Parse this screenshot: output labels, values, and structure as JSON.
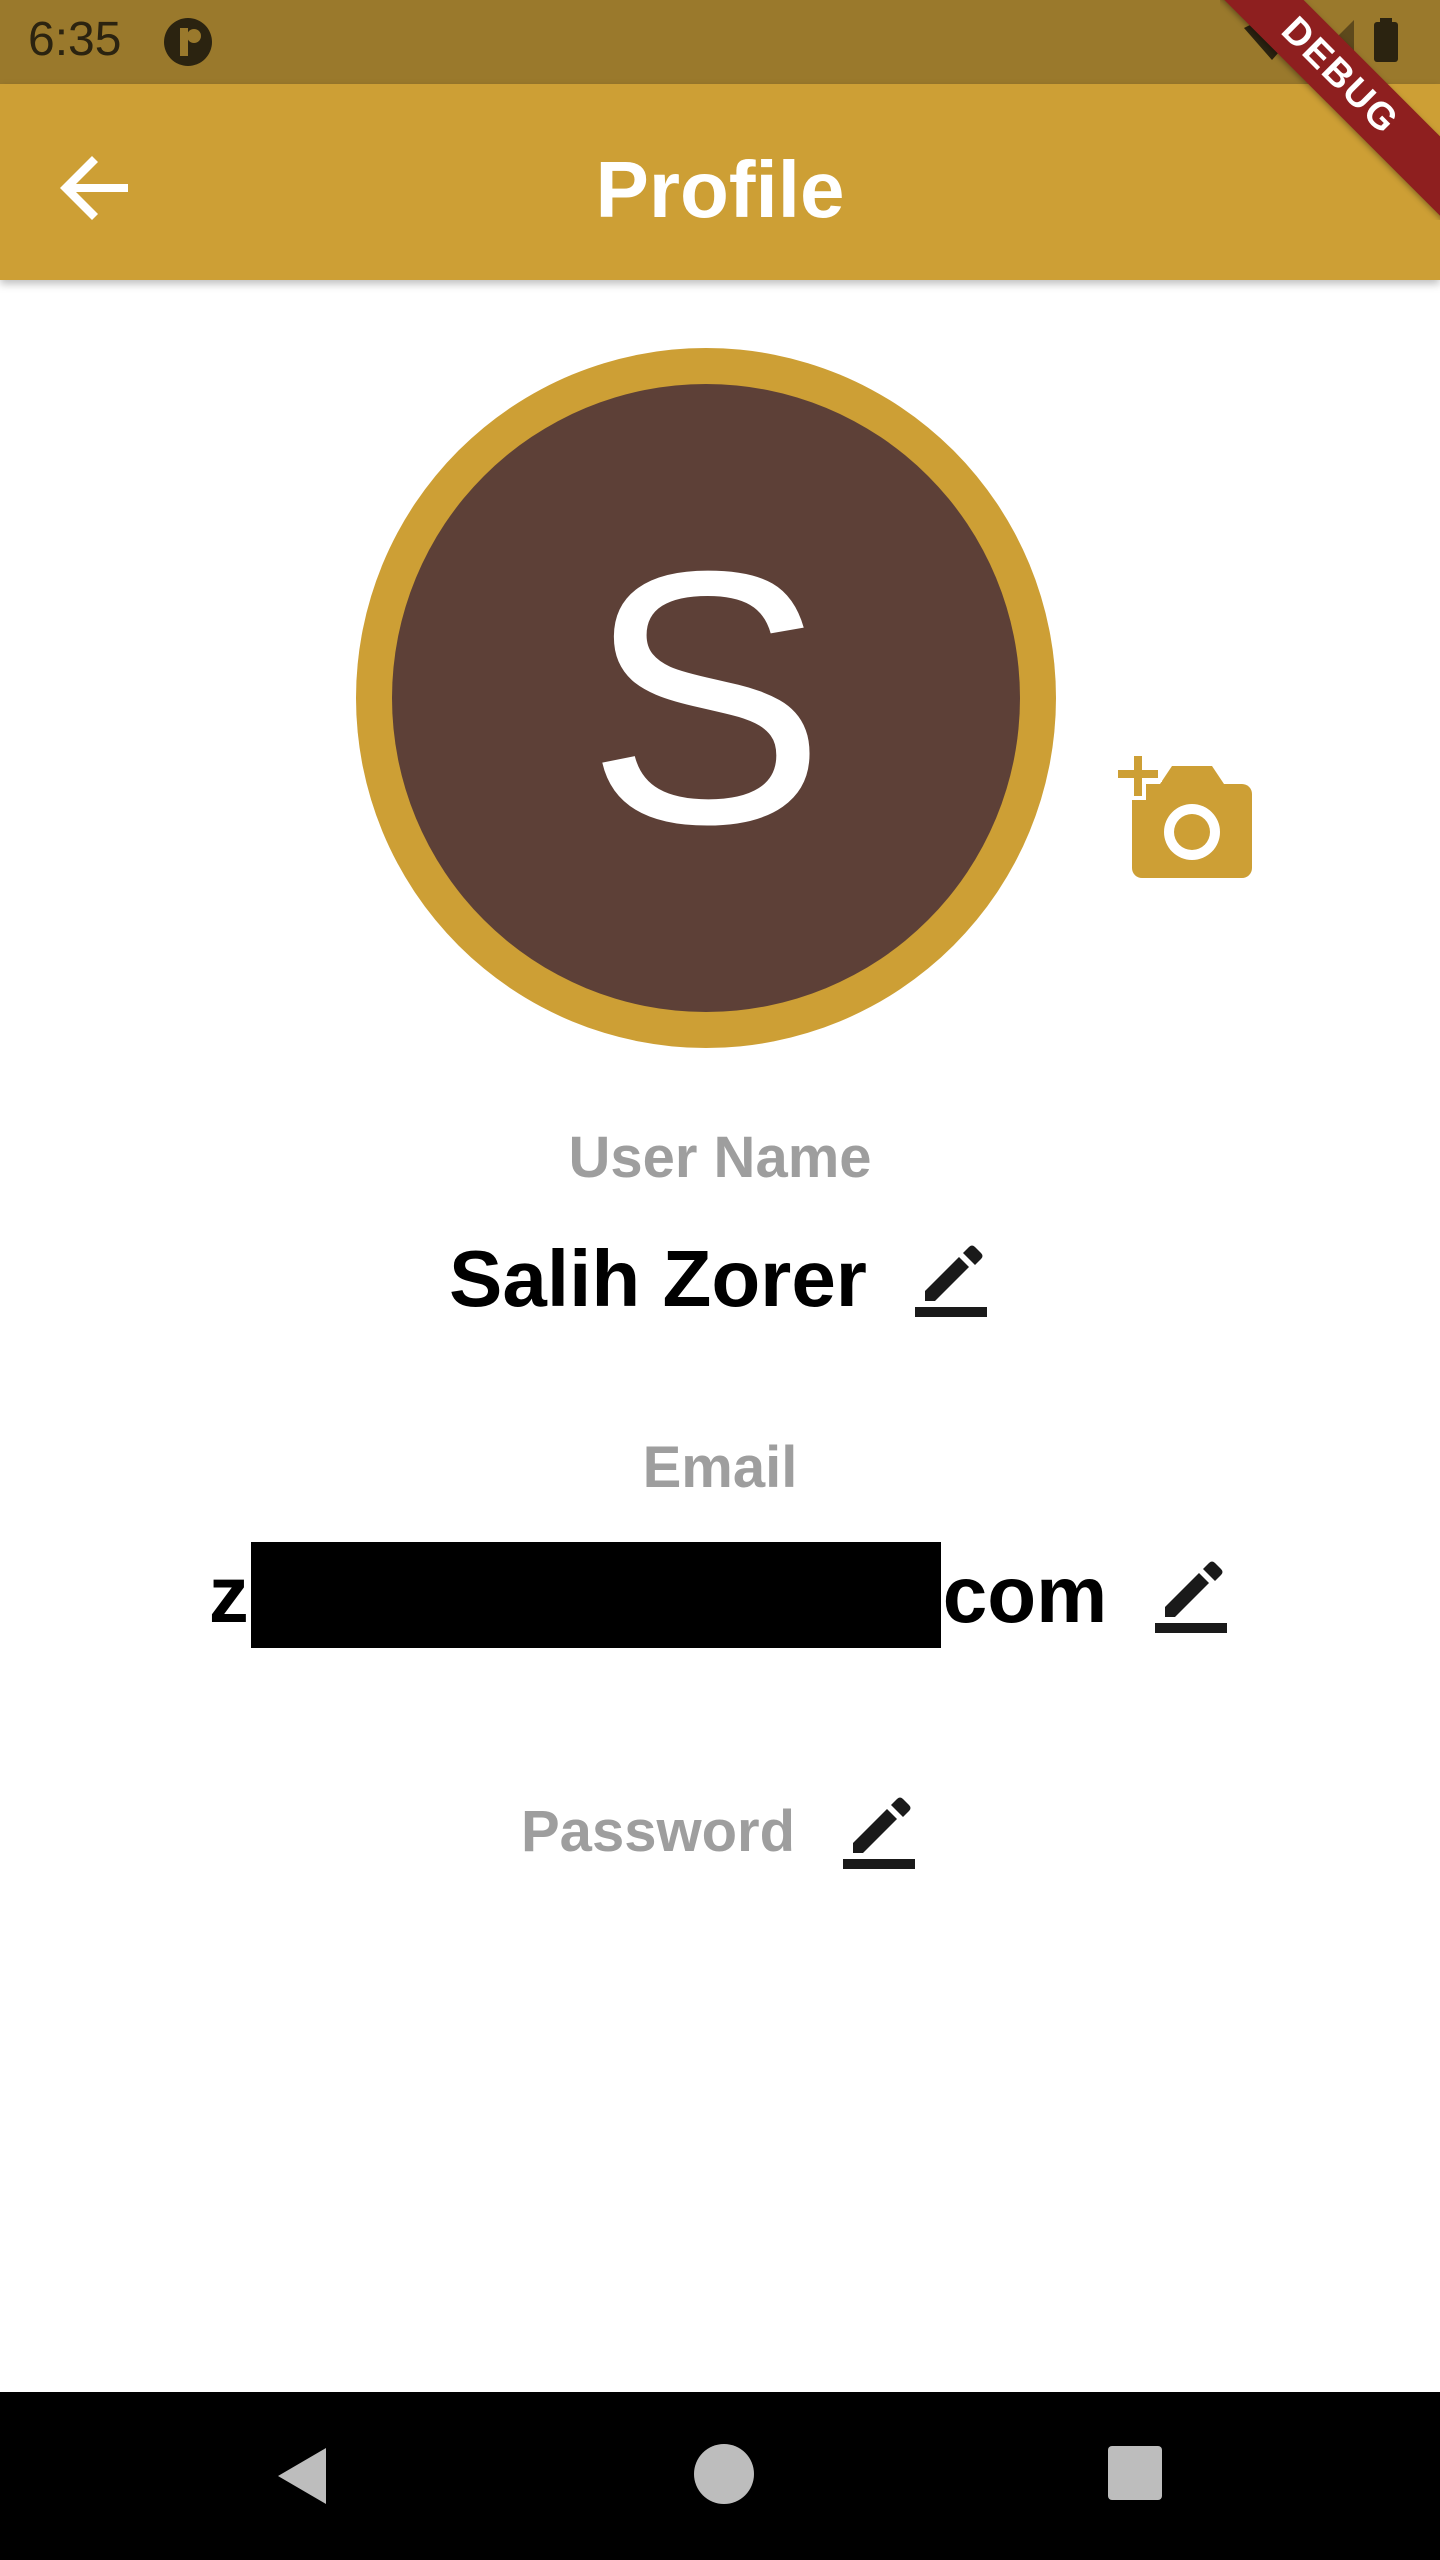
{
  "status_bar": {
    "time": "6:35"
  },
  "app_bar": {
    "title": "Profile",
    "color": "#cd9f35"
  },
  "debug_banner": {
    "text": "DEBUG"
  },
  "avatar": {
    "letter": "S",
    "ring_color": "#cd9f35",
    "fill_color": "#5d4037"
  },
  "fields": {
    "username_label": "User Name",
    "username_value": "Salih Zorer",
    "email_label": "Email",
    "email_prefix": "z",
    "email_suffix": "com",
    "password_label": "Password"
  },
  "icons": {
    "back": "arrow-back-icon",
    "add_photo": "add-a-photo-icon",
    "edit": "pencil-edit-icon"
  }
}
